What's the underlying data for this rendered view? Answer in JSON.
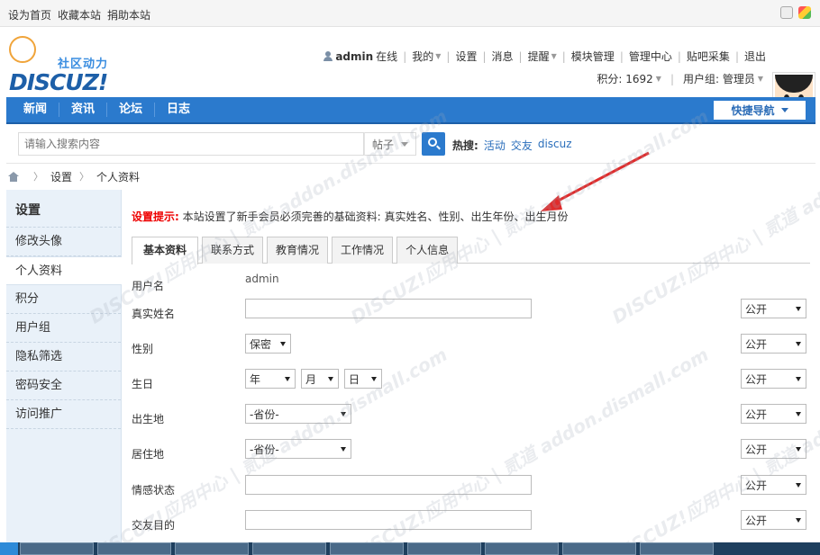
{
  "topbar": {
    "links": [
      "设为首页",
      "收藏本站",
      "捐助本站"
    ]
  },
  "logo": {
    "tagline": "社区动力",
    "wordmark": "DISCUZ!"
  },
  "user": {
    "name": "admin",
    "status": "在线",
    "menu": [
      "我的",
      "设置",
      "消息",
      "提醒",
      "模块管理",
      "管理中心",
      "贴吧采集",
      "退出"
    ],
    "points_label": "积分: 1692",
    "group_label": "用户组: 管理员"
  },
  "nav": {
    "items": [
      "新闻",
      "资讯",
      "论坛",
      "日志"
    ],
    "quick_nav": "快捷导航"
  },
  "search": {
    "placeholder": "请输入搜索内容",
    "type": "帖子",
    "hot_label": "热搜:",
    "hot_links": [
      "活动",
      "交友",
      "discuz"
    ]
  },
  "breadcrumb": [
    "设置",
    "个人资料"
  ],
  "sidebar": {
    "title": "设置",
    "items": [
      "修改头像",
      "个人资料",
      "积分",
      "用户组",
      "隐私筛选",
      "密码安全",
      "访问推广"
    ]
  },
  "notice": {
    "hint": "设置提示:",
    "text": "本站设置了新手会员必须完善的基础资料: 真实姓名、性别、出生年份、出生月份"
  },
  "tabs": [
    "基本资料",
    "联系方式",
    "教育情况",
    "工作情况",
    "个人信息"
  ],
  "form": {
    "username_label": "用户名",
    "username_value": "admin",
    "realname_label": "真实姓名",
    "gender_label": "性别",
    "gender_value": "保密",
    "birthday_label": "生日",
    "year_value": "年",
    "month_value": "月",
    "day_value": "日",
    "birthplace_label": "出生地",
    "birthplace_value": "-省份-",
    "residence_label": "居住地",
    "residence_value": "-省份-",
    "relationship_label": "情感状态",
    "purpose_label": "交友目的",
    "privacy_value": "公开"
  },
  "watermark": "DISCUZ!应用中心 | 贰道 addon.dismall.com",
  "colors": {
    "nav_blue": "#2b7acd",
    "sidebar_bg": "#e9f1f9",
    "hint_red": "#ee0000",
    "link_blue": "#2a6ebb"
  }
}
